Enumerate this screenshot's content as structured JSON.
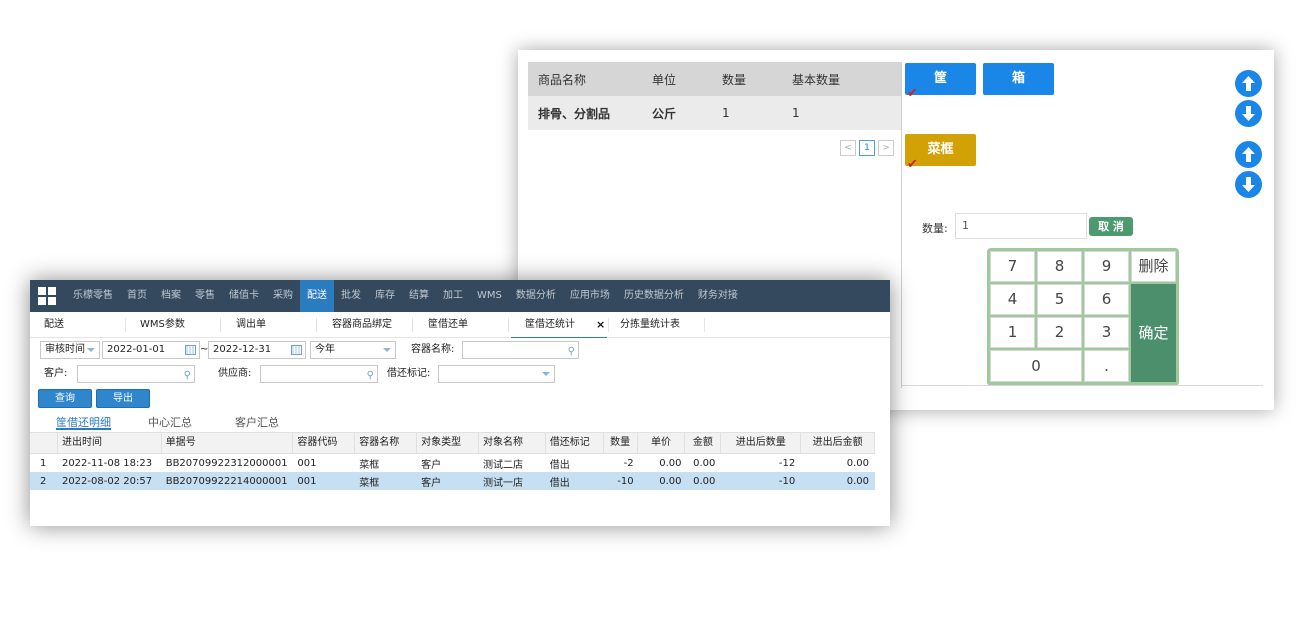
{
  "back_window": {
    "table": {
      "headers": [
        "商品名称",
        "单位",
        "数量",
        "基本数量"
      ],
      "rows": [
        [
          "排骨、分割品",
          "公斤",
          "1",
          "1"
        ]
      ]
    },
    "pager": {
      "prev": "<",
      "page": "1",
      "next": ">"
    },
    "container_types": [
      {
        "label": "筐",
        "color": "#1a86e8"
      },
      {
        "label": "箱",
        "color": "#1a86e8"
      },
      {
        "label": "菜框",
        "color": "#d1a106"
      }
    ],
    "check_mark": "✔",
    "qty_label": "数量:",
    "qty_value": "1",
    "cancel_label": "取 消",
    "keypad": {
      "keys": [
        "7",
        "8",
        "9",
        "删除",
        "4",
        "5",
        "6",
        "1",
        "2",
        "3",
        "0",
        "."
      ],
      "confirm": "确定"
    }
  },
  "front_window": {
    "nav": {
      "items": [
        "乐檬零售",
        "首页",
        "档案",
        "零售",
        "储值卡",
        "采购",
        "配送",
        "批发",
        "库存",
        "结算",
        "加工",
        "WMS",
        "数据分析",
        "应用市场",
        "历史数据分析",
        "财务对接"
      ],
      "active": "配送"
    },
    "subtabs": [
      "配送",
      "WMS参数",
      "调出单",
      "容器商品绑定",
      "筐借还单",
      "筐借还统计",
      "分拣量统计表"
    ],
    "active_subtab": "筐借还统计",
    "close_glyph": "×",
    "filters": {
      "date_type": "审核时间",
      "date_from": "2022-01-01",
      "date_sep": "~",
      "date_to": "2022-12-31",
      "period": "今年",
      "container_name_label": "容器名称:",
      "container_name_value": "",
      "customer_label": "客户:",
      "customer_value": "",
      "supplier_label": "供应商:",
      "supplier_value": "",
      "borrow_flag_label": "借还标记:",
      "borrow_flag_value": ""
    },
    "buttons": {
      "query": "查询",
      "export": "导出"
    },
    "detail_tabs": [
      "筐借还明细",
      "中心汇总",
      "客户汇总"
    ],
    "grid": {
      "headers": [
        "",
        "进出时间",
        "单据号",
        "容器代码",
        "容器名称",
        "对象类型",
        "对象名称",
        "借还标记",
        "数量",
        "单价",
        "金额",
        "进出后数量",
        "进出后金额"
      ],
      "rows": [
        [
          "1",
          "2022-11-08 18:23",
          "BB20709922312000001",
          "001",
          "菜框",
          "客户",
          "测试二店",
          "借出",
          "-2",
          "0.00",
          "0.00",
          "-12",
          "0.00"
        ],
        [
          "2",
          "2022-08-02 20:57",
          "BB20709922214000001",
          "001",
          "菜框",
          "客户",
          "测试一店",
          "借出",
          "-10",
          "0.00",
          "0.00",
          "-10",
          "0.00"
        ]
      ],
      "selected_row": 2
    }
  }
}
